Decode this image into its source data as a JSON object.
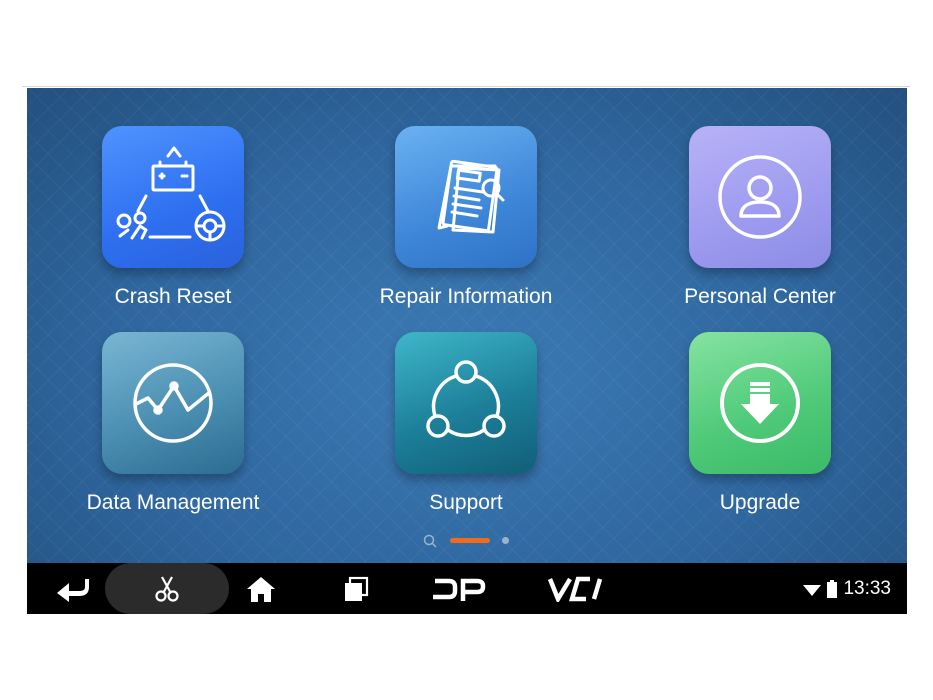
{
  "apps": [
    {
      "label": "Crash Reset",
      "icon": "crash-reset-icon"
    },
    {
      "label": "Repair Information",
      "icon": "repair-information-icon"
    },
    {
      "label": "Personal Center",
      "icon": "person-icon"
    },
    {
      "label": "Data Management",
      "icon": "data-chart-icon"
    },
    {
      "label": "Support",
      "icon": "support-share-icon"
    },
    {
      "label": "Upgrade",
      "icon": "download-icon"
    }
  ],
  "pager": {
    "pages": 2,
    "current": 1
  },
  "navbar": {
    "brand": "DP",
    "vci": "VCI",
    "time": "13:33"
  },
  "colors": {
    "accent": "#f26b1d",
    "wallpaper": "#2f679f",
    "navbar": "#000000"
  }
}
